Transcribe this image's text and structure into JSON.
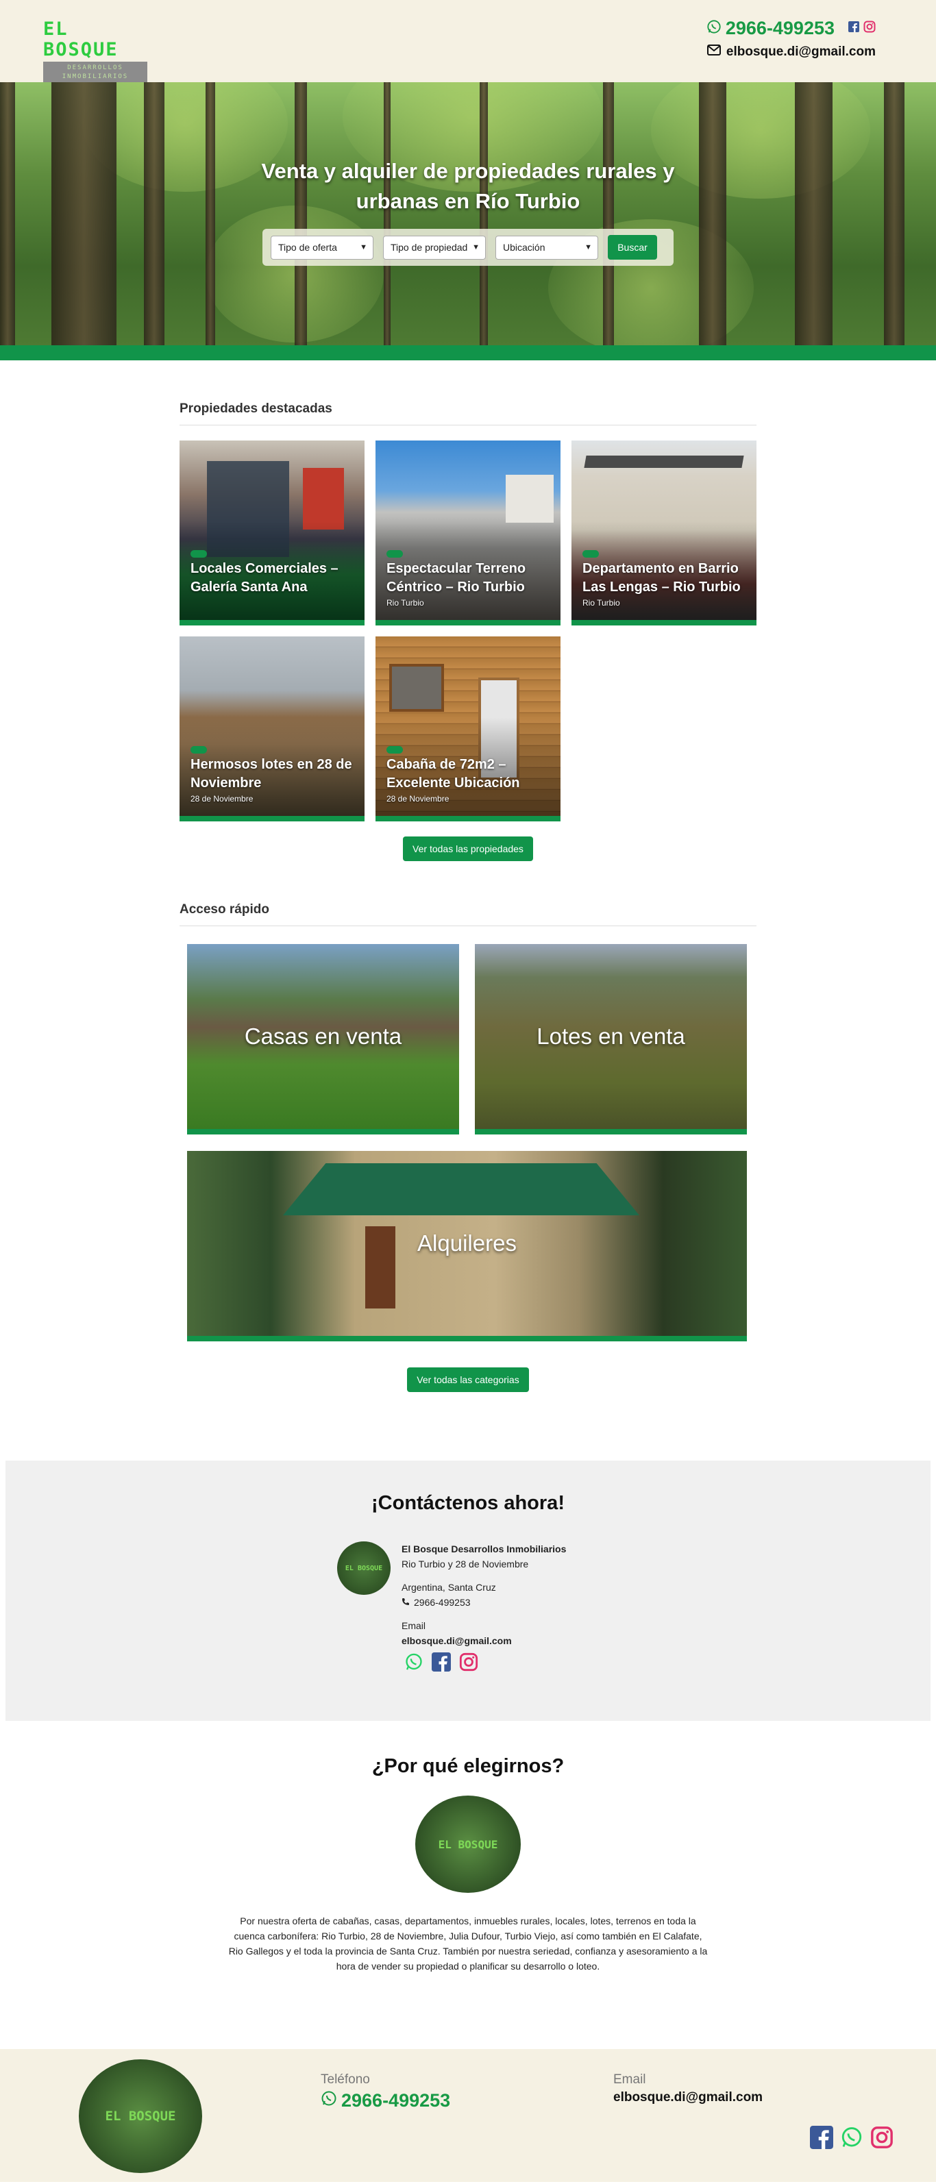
{
  "header": {
    "logo_title": "EL BOSQUE",
    "logo_subtitle": "DESARROLLOS INMOBILIARIOS",
    "phone": "2966-499253",
    "email": "elbosque.di@gmail.com",
    "icons": [
      "whatsapp-icon",
      "facebook-icon",
      "instagram-icon",
      "envelope-icon"
    ]
  },
  "hero": {
    "title_line1": "Venta y alquiler de propiedades rurales y",
    "title_line2": "urbanas en Río Turbio",
    "search": {
      "offer_type": "Tipo de oferta",
      "property_type": "Tipo de propiedad",
      "location": "Ubicación",
      "button": "Buscar"
    }
  },
  "featured": {
    "title": "Propiedades destacadas",
    "items": [
      {
        "name": "Locales Comerciales – Galería Santa Ana",
        "location": ""
      },
      {
        "name": "Espectacular Terreno Céntrico – Rio Turbio",
        "location": "Rio Turbio"
      },
      {
        "name": "Departamento en Barrio Las Lengas – Rio Turbio",
        "location": "Rio Turbio"
      },
      {
        "name": "Hermosos lotes en 28 de Noviembre",
        "location": "28 de Noviembre"
      },
      {
        "name": "Cabaña de 72m2 – Excelente Ubicación",
        "location": "28 de Noviembre"
      }
    ],
    "button": "Ver todas las propiedades"
  },
  "quick_access": {
    "title": "Acceso rápido",
    "items": [
      {
        "label": "Casas en venta"
      },
      {
        "label": "Lotes en venta"
      },
      {
        "label": "Alquileres"
      }
    ],
    "button": "Ver todas las categorias"
  },
  "contact": {
    "title": "¡Contáctenos ahora!",
    "company": "El Bosque Desarrollos Inmobiliarios",
    "address": "Rio Turbio y 28 de Noviembre",
    "region": "Argentina, Santa Cruz",
    "phone": "2966-499253",
    "email_label": "Email",
    "email": "elbosque.di@gmail.com"
  },
  "why": {
    "title": "¿Por qué elegirnos?",
    "text": "Por nuestra oferta de cabañas, casas, departamentos, inmuebles rurales, locales, lotes, terrenos en toda la cuenca carbonífera: Rio Turbio, 28 de Noviembre, Julia Dufour, Turbio Viejo, así como también en El Calafate, Rio Gallegos y el toda la provincia de Santa Cruz. También por nuestra seriedad, confianza y asesoramiento a la hora de vender su propiedad o planificar su desarrollo o loteo."
  },
  "footer": {
    "phone_label": "Teléfono",
    "phone": "2966-499253",
    "email_label": "Email",
    "email": "elbosque.di@gmail.com"
  },
  "colors": {
    "brand_green": "#11944a",
    "phone_green": "#189a45",
    "cream": "#f5f1e3",
    "facebook": "#3b5998",
    "whatsapp": "#25d366",
    "instagram": "#e1306c"
  }
}
